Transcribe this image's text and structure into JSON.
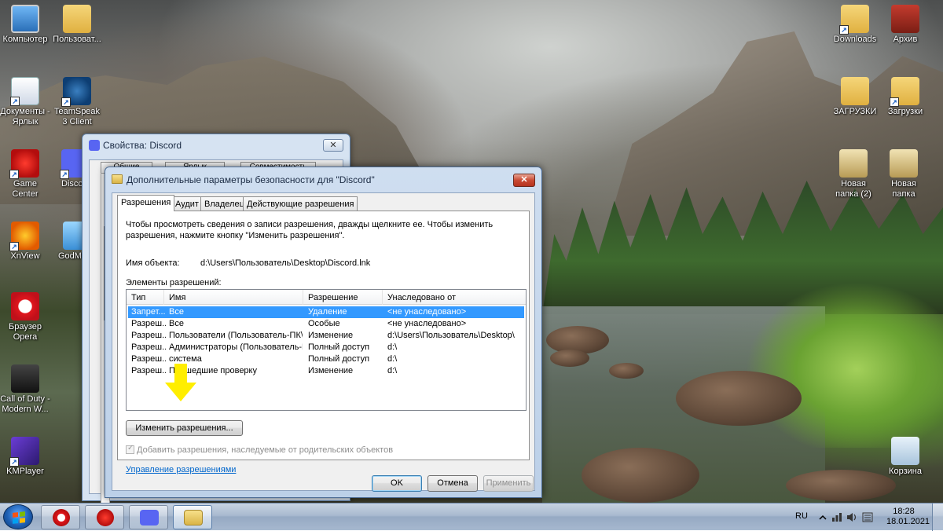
{
  "desktop": {
    "icons_left": [
      {
        "label": "Компьютер",
        "icon": "computer-icon"
      },
      {
        "label": "Пользоват...",
        "icon": "user-folder-icon"
      },
      {
        "label": "Документы - Ярлык",
        "icon": "documents-shortcut-icon"
      },
      {
        "label": "TeamSpeak 3 Client",
        "icon": "teamspeak-icon"
      },
      {
        "label": "Game Center",
        "icon": "game-center-icon"
      },
      {
        "label": "Disco",
        "icon": "discord-icon"
      },
      {
        "label": "XnView",
        "icon": "xnview-icon"
      },
      {
        "label": "GodM",
        "icon": "godmode-icon"
      },
      {
        "label": "Браузер Opera",
        "icon": "opera-icon"
      },
      {
        "label": "Call of Duty - Modern W...",
        "icon": "call-of-duty-icon"
      },
      {
        "label": "KMPlayer",
        "icon": "kmplayer-icon"
      }
    ],
    "icons_right": [
      {
        "label": "Downloads",
        "icon": "downloads-folder-icon"
      },
      {
        "label": "Архив",
        "icon": "archive-icon"
      },
      {
        "label": "ЗАГРУЗКИ",
        "icon": "folder-icon"
      },
      {
        "label": "Загрузки",
        "icon": "downloads-shortcut-icon"
      },
      {
        "label": "Новая папка (2)",
        "icon": "folder-icon"
      },
      {
        "label": "Новая папка",
        "icon": "folder-icon"
      },
      {
        "label": "Корзина",
        "icon": "recycle-bin-icon"
      }
    ]
  },
  "props_window": {
    "title": "Свойства: Discord",
    "tabs": [
      "Общие",
      "Ярлык",
      "Совместимость"
    ],
    "close_glyph": "✕"
  },
  "security_window": {
    "title": "Дополнительные параметры безопасности  для \"Discord\"",
    "close_glyph": "✕",
    "tabs": [
      "Разрешения",
      "Аудит",
      "Владелец",
      "Действующие разрешения"
    ],
    "instructions": "Чтобы просмотреть сведения о записи разрешения, дважды щелкните ее. Чтобы изменить разрешения, нажмите кнопку \"Изменить разрешения\".",
    "object_label": "Имя объекта:",
    "object_path": "d:\\Users\\Пользователь\\Desktop\\Discord.lnk",
    "entries_label": "Элементы разрешений:",
    "columns": {
      "type": "Тип",
      "name": "Имя",
      "permission": "Разрешение",
      "inherited": "Унаследовано от"
    },
    "rows": [
      {
        "type": "Запрет...",
        "name": "Все",
        "permission": "Удаление",
        "inherited": "<не унаследовано>"
      },
      {
        "type": "Разреш...",
        "name": "Все",
        "permission": "Особые",
        "inherited": "<не унаследовано>"
      },
      {
        "type": "Разреш...",
        "name": "Пользователи (Пользователь-ПК\\...",
        "permission": "Изменение",
        "inherited": "d:\\Users\\Пользователь\\Desktop\\"
      },
      {
        "type": "Разреш...",
        "name": "Администраторы (Пользователь-П...",
        "permission": "Полный доступ",
        "inherited": "d:\\"
      },
      {
        "type": "Разреш...",
        "name": "система",
        "permission": "Полный доступ",
        "inherited": "d:\\"
      },
      {
        "type": "Разреш...",
        "name": "Прошедшие проверку",
        "permission": "Изменение",
        "inherited": "d:\\"
      }
    ],
    "change_button": "Изменить разрешения...",
    "inherit_checkbox": "Добавить разрешения, наследуемые от родительских объектов",
    "manage_link": "Управление разрешениями",
    "ok": "OK",
    "cancel": "Отмена",
    "apply": "Применить"
  },
  "taskbar": {
    "apps": [
      "opera-icon",
      "game-center-icon",
      "discord-icon",
      "folder-icon"
    ],
    "language": "RU",
    "time": "18:28",
    "date": "18.01.2021"
  },
  "colors": {
    "selection": "#3399ff",
    "link": "#0066cc",
    "annotation_arrow": "#ffee00"
  }
}
